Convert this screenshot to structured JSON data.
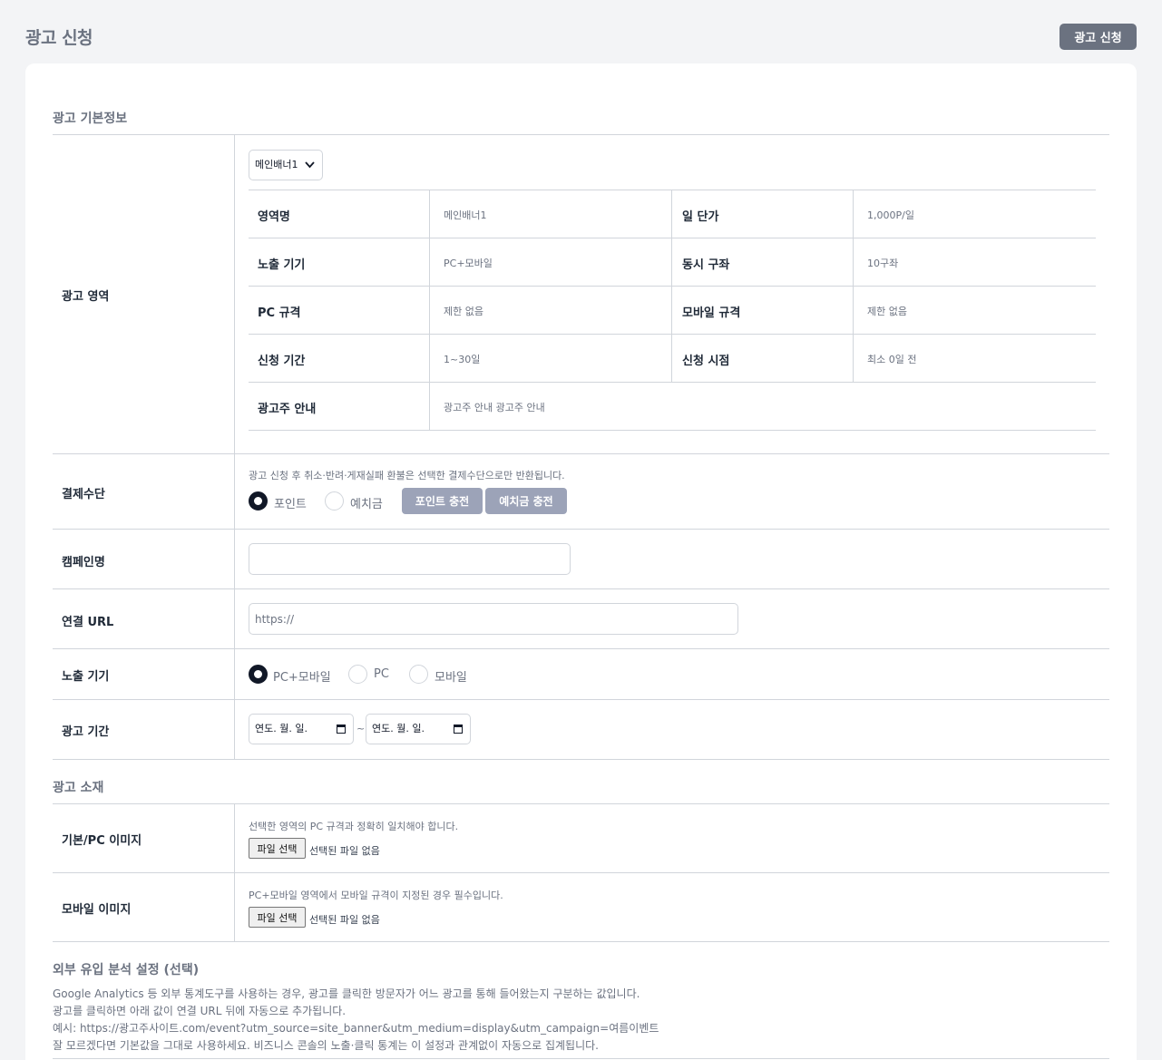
{
  "page_title": "광고 신청",
  "top_button": "광고 신청",
  "sections": {
    "basic": "광고 기본정보",
    "material": "광고 소재",
    "external": "외부 유입 분석 설정 (선택)"
  },
  "ad_area": {
    "label": "광고 영역",
    "selected": "메인배너1",
    "info": {
      "area_name_k": "영역명",
      "area_name_v": "메인배너1",
      "daily_price_k": "일 단가",
      "daily_price_v": "1,000P/일",
      "device_k": "노출 기기",
      "device_v": "PC+모바일",
      "slots_k": "동시 구좌",
      "slots_v": "10구좌",
      "pc_spec_k": "PC 규격",
      "pc_spec_v": "제한 없음",
      "mobile_spec_k": "모바일 규격",
      "mobile_spec_v": "제한 없음",
      "period_k": "신청 기간",
      "period_v": "1~30일",
      "timing_k": "신청 시점",
      "timing_v": "최소 0일 전",
      "guide_k": "광고주 안내",
      "guide_v": "광고주 안내 광고주 안내"
    }
  },
  "payment": {
    "label": "결제수단",
    "note": "광고 신청 후 취소·반려·게재실패 환불은 선택한 결제수단으로만 반환됩니다.",
    "options": [
      "포인트",
      "예치금"
    ],
    "selected_index": 0,
    "charge_point": "포인트 충전",
    "charge_deposit": "예치금 충전"
  },
  "campaign": {
    "label": "캠페인명",
    "value": ""
  },
  "url": {
    "label": "연결 URL",
    "value": "https://"
  },
  "device": {
    "label": "노출 기기",
    "options": [
      "PC+모바일",
      "PC",
      "모바일"
    ],
    "selected_index": 0
  },
  "period": {
    "label": "광고 기간",
    "start": "연도. 월. 일.",
    "end": "연도. 월. 일.",
    "separator": "~"
  },
  "pc_image": {
    "label": "기본/PC 이미지",
    "note": "선택한 영역의 PC 규격과 정확히 일치해야 합니다.",
    "button": "파일 선택",
    "status": "선택된 파일 없음"
  },
  "mobile_image": {
    "label": "모바일 이미지",
    "note": "PC+모바일 영역에서 모바일 규격이 지정된 경우 필수입니다.",
    "button": "파일 선택",
    "status": "선택된 파일 없음"
  },
  "external_text": [
    "Google Analytics 등 외부 통계도구를 사용하는 경우, 광고를 클릭한 방문자가 어느 광고를 통해 들어왔는지 구분하는 값입니다.",
    "광고를 클릭하면 아래 값이 연결 URL 뒤에 자동으로 추가됩니다.",
    "예시: https://광고주사이트.com/event?utm_source=site_banner&utm_medium=display&utm_campaign=여름이벤트",
    "잘 모르겠다면 기본값을 그대로 사용하세요. 비즈니스 콘솔의 노출·클릭 통계는 이 설정과 관계없이 자동으로 집계됩니다."
  ]
}
